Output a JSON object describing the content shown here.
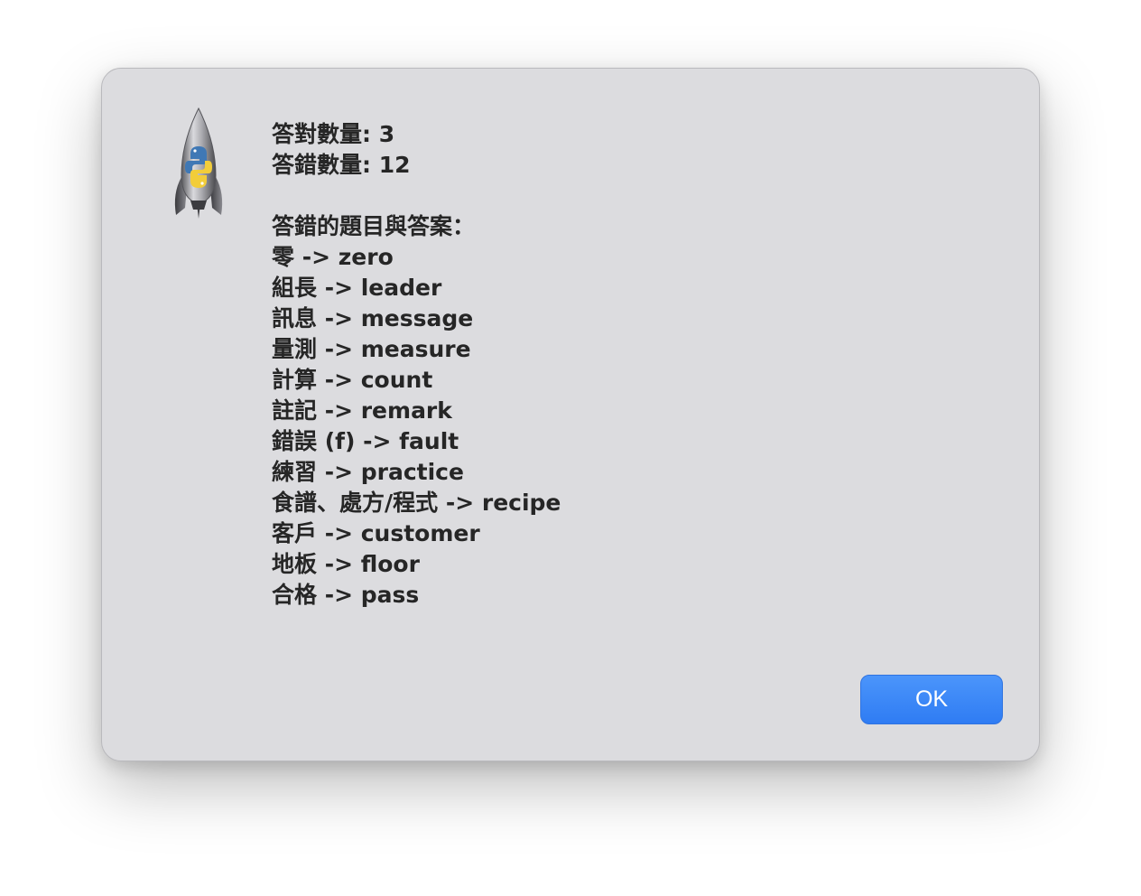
{
  "dialog": {
    "icon": "python-launcher-rocket-icon",
    "score": {
      "correct": "答對數量: 3",
      "wrong": "答錯數量: 12"
    },
    "wrong_header": "答錯的題目與答案：",
    "wrong_items": [
      "零 -> zero",
      "組長 -> leader",
      "訊息 -> message",
      "量測 -> measure",
      "計算 -> count",
      "註記 -> remark",
      "錯誤 (f) -> fault",
      "練習 -> practice",
      "食譜、處方/程式 -> recipe",
      "客戶 -> customer",
      "地板 -> floor",
      "合格 -> pass"
    ],
    "ok_label": "OK"
  },
  "colors": {
    "dialog_bg": "#dcdcdf",
    "button_accent": "#3a86f7",
    "text": "#262626"
  }
}
